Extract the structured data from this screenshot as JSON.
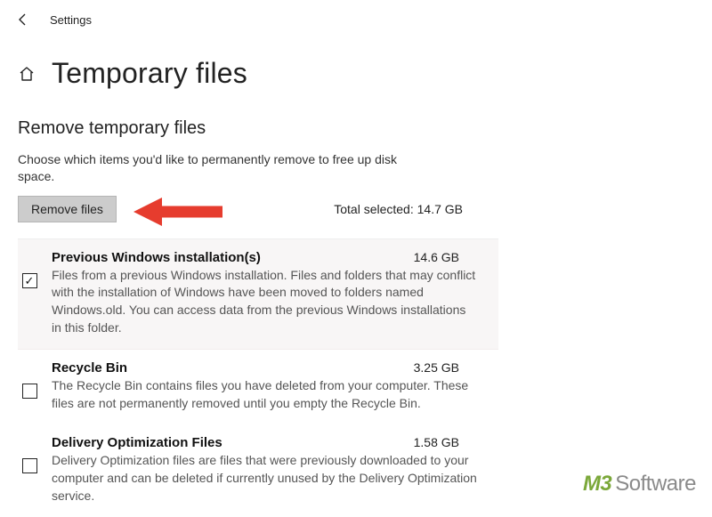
{
  "titlebar": {
    "label": "Settings"
  },
  "header": {
    "title": "Temporary files"
  },
  "section": {
    "title": "Remove temporary files",
    "description": "Choose which items you'd like to permanently remove to free up disk space."
  },
  "action": {
    "remove_label": "Remove files",
    "total_selected_prefix": "Total selected: ",
    "total_selected_value": "14.7 GB"
  },
  "items": [
    {
      "title": "Previous Windows installation(s)",
      "size": "14.6 GB",
      "checked": true,
      "desc": "Files from a previous Windows installation.  Files and folders that may conflict with the installation of Windows have been moved to folders named Windows.old.  You can access data from the previous Windows installations in this folder."
    },
    {
      "title": "Recycle Bin",
      "size": "3.25 GB",
      "checked": false,
      "desc": "The Recycle Bin contains files you have deleted from your computer. These files are not permanently removed until you empty the Recycle Bin."
    },
    {
      "title": "Delivery Optimization Files",
      "size": "1.58 GB",
      "checked": false,
      "desc": "Delivery Optimization files are files that were previously downloaded to your computer and can be deleted if currently unused by the Delivery Optimization service."
    }
  ],
  "watermark": {
    "brand_prefix": "M3",
    "brand_suffix": "Software"
  }
}
